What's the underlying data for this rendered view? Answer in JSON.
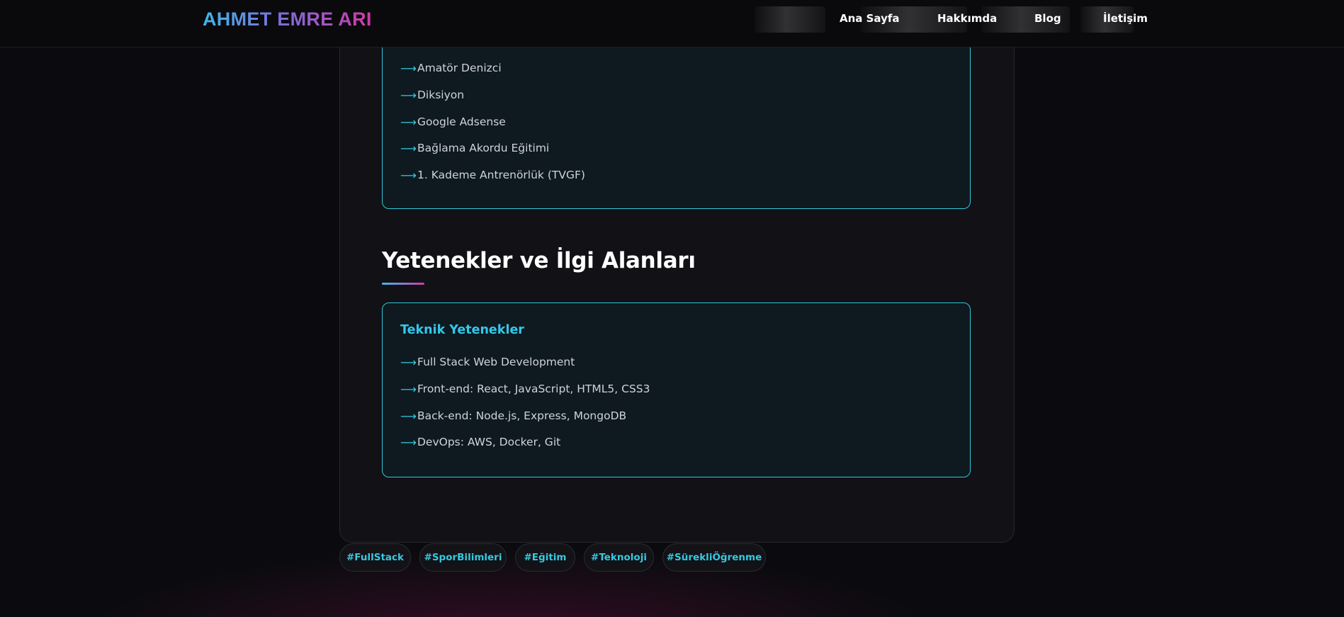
{
  "header": {
    "brand": "AHMET EMRE ARI",
    "nav": [
      "Ana Sayfa",
      "Hakkımda",
      "Blog",
      "İletişim"
    ]
  },
  "certificates": {
    "items": [
      "Amatör Denizci",
      "Diksiyon",
      "Google Adsense",
      "Bağlama Akordu Eğitimi",
      "1. Kademe Antrenörlük (TVGF)"
    ]
  },
  "skills_section": {
    "title": "Yetenekler ve İlgi Alanları",
    "technical": {
      "heading": "Teknik Yetenekler",
      "items": [
        "Full Stack Web Development",
        "Front-end: React, JavaScript, HTML5, CSS3",
        "Back-end: Node.js, Express, MongoDB",
        "DevOps: AWS, Docker, Git"
      ]
    }
  },
  "tags": [
    "#FullStack",
    "#SporBilimleri",
    "#Eğitim",
    "#Teknoloji",
    "#SürekliÖğrenme"
  ],
  "icons": {
    "list_bullet": "arrow-right-icon"
  },
  "colors": {
    "accent_cyan": "#36c9e0",
    "gradient_start": "#40b8ea",
    "gradient_end": "#d03aa7",
    "background": "#0b0b0f"
  }
}
